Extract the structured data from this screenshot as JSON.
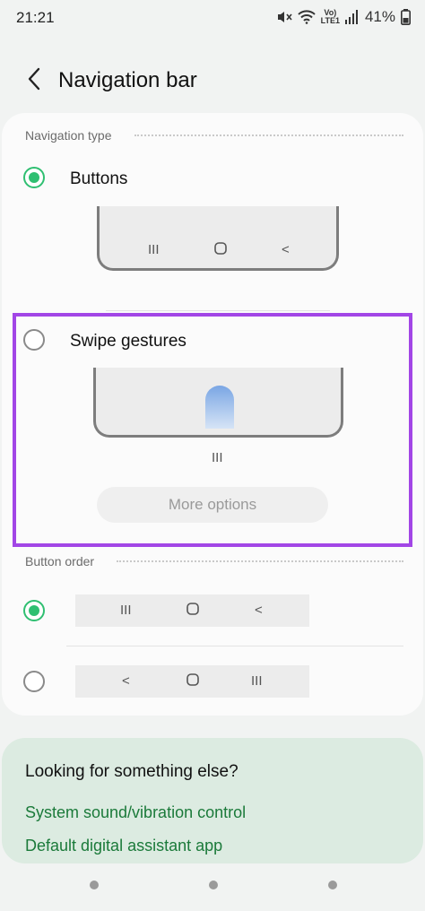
{
  "status_bar": {
    "time": "21:21",
    "network_label": "LTE1",
    "battery": "41%",
    "icons": [
      "mute-icon",
      "wifi-icon",
      "volte-icon",
      "signal-icon",
      "battery-icon"
    ]
  },
  "header": {
    "title": "Navigation bar",
    "back_icon": "chevron-left-icon"
  },
  "navigation_type": {
    "section_label": "Navigation type",
    "options": [
      {
        "label": "Buttons",
        "selected": true,
        "preview_glyphs": [
          "III",
          "O",
          "<"
        ]
      },
      {
        "label": "Swipe gestures",
        "selected": false,
        "handle_glyph": "III",
        "more_options_label": "More options"
      }
    ]
  },
  "button_order": {
    "section_label": "Button order",
    "options": [
      {
        "selected": true,
        "glyphs": [
          "III",
          "O",
          "<"
        ]
      },
      {
        "selected": false,
        "glyphs": [
          "<",
          "O",
          "III"
        ]
      }
    ]
  },
  "suggestions": {
    "title": "Looking for something else?",
    "links": [
      "System sound/vibration control",
      "Default digital assistant app"
    ]
  },
  "colors": {
    "accent_green": "#2fbf71",
    "link_green": "#1b7a3a",
    "highlight_purple": "#a246e6",
    "suggestion_bg": "#dcebe1"
  }
}
